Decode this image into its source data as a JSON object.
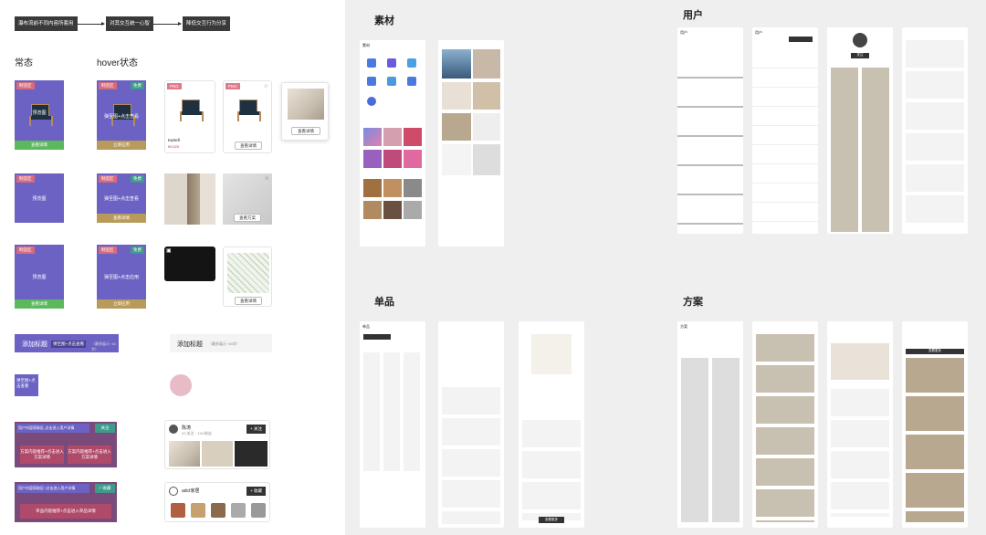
{
  "flow": {
    "step1": "瀑布流前不同内容所套用",
    "step2": "对其交互统一心智",
    "step3": "降低交互行为分享"
  },
  "states": {
    "normal": "常态",
    "hover": "hover状态"
  },
  "cards": {
    "tag_material": "制造区",
    "hover_text1": "预览图",
    "hover_text2": "弹至图+点击查看",
    "hover_text3": "弹至图+点击应用",
    "btn_view": "查看详情",
    "btn_apply": "立即应用",
    "btn_detail": "查看详情",
    "tag_png": "PNG",
    "tag_free": "免费",
    "product_name": "Kartell",
    "product_sub": "会员价",
    "product_price": "¥3,020",
    "product_old": "¥5,800",
    "scheme_btn": "查看方案"
  },
  "addtitle": {
    "main": "添加标题",
    "sub": "弹至图+点击查看",
    "hint": "（最多展示~40字）",
    "alt_main": "添加标题",
    "alt_hint": "（最多展示~40字）",
    "small": "弹至图+点击查看"
  },
  "social": {
    "user_name": "陈涛",
    "user_meta": "22 关注 · 134 粉丝",
    "follow_btn": "+ 关注",
    "brand_name": "adct家居",
    "brand_btn": "+ 收藏",
    "row1": "用户内容获取区-点击进入用户详情",
    "row1_btn": "关注",
    "row1_left": "方案内容推荐+点击进入方案详情",
    "row1_right": "方案内容推荐+点击进入方案详情",
    "row2": "用户内容获取区+点击进入用户详情",
    "row2_btn": "+ 收藏",
    "row2_bottom": "单品内容推荐+点击进入单品详情"
  },
  "right": {
    "material": "素材",
    "user": "用户",
    "product": "单品",
    "scheme": "方案",
    "phone_material_title": "素材",
    "phone_user_title": "用户",
    "phone_product_title": "单品",
    "phone_scheme_title": "方案",
    "more_btn": "查看更多",
    "follow": "关注"
  },
  "colors": {
    "purple": "#6b62c4",
    "red_tag": "#d96a7a",
    "green_tag": "#3e9a8a",
    "green_bar": "#5cb85c",
    "gold_bar": "#b89a5a",
    "pink": "#b04a6a",
    "dark": "#3a3a3a"
  }
}
